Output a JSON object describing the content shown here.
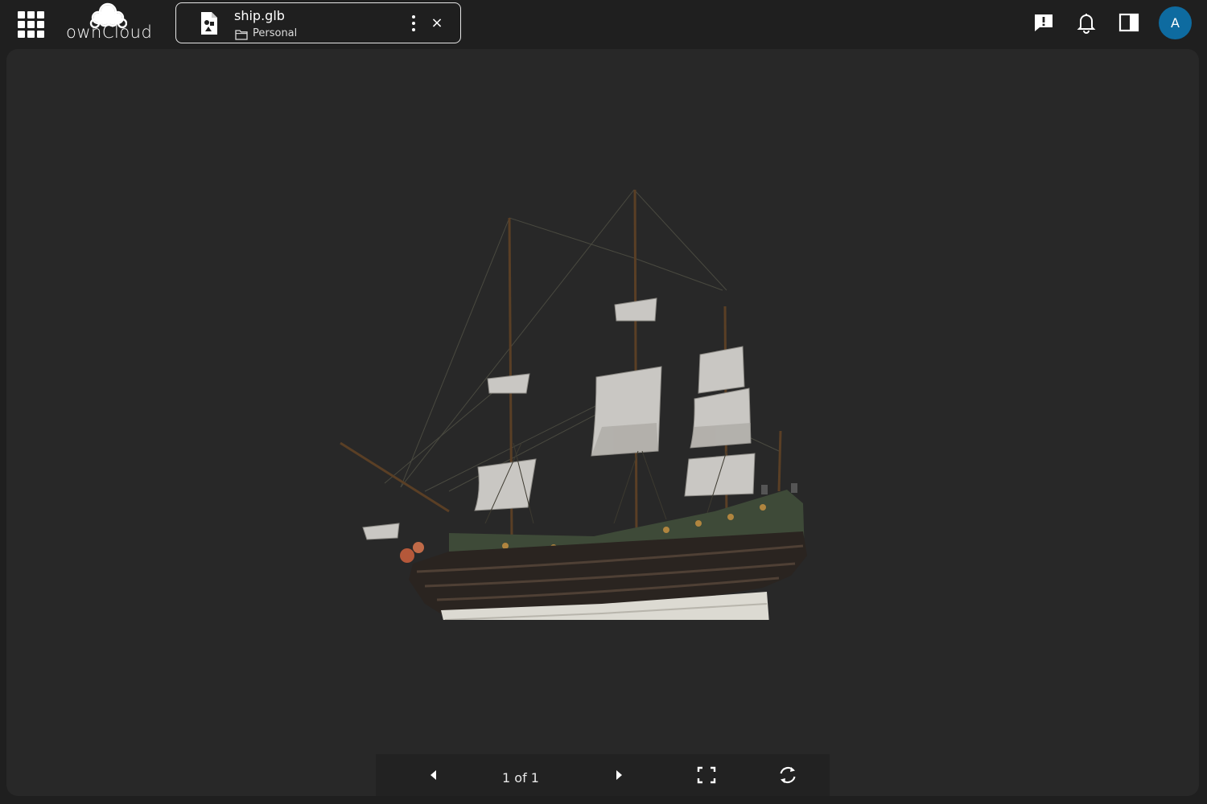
{
  "topbar": {
    "brand": "ownCloud",
    "app_switcher_icon": "apps-grid-icon",
    "file": {
      "name": "ship.glb",
      "location": "Personal",
      "file_icon": "3d-file-icon",
      "location_icon": "folder-icon",
      "actions_icon": "more-vertical-icon",
      "close_label": "×"
    },
    "actions": {
      "feedback_icon": "feedback-icon",
      "notifications_icon": "bell-icon",
      "sidebar_icon": "sidebar-panel-icon"
    },
    "user": {
      "initial": "A",
      "color": "#0e6ba0"
    }
  },
  "viewer": {
    "model_name": "ship.glb",
    "background": "#282828",
    "controls": {
      "previous_icon": "caret-left-icon",
      "counter": "1 of 1",
      "next_icon": "caret-right-icon",
      "fullscreen_icon": "fullscreen-icon",
      "reset_icon": "reset-view-icon"
    }
  }
}
